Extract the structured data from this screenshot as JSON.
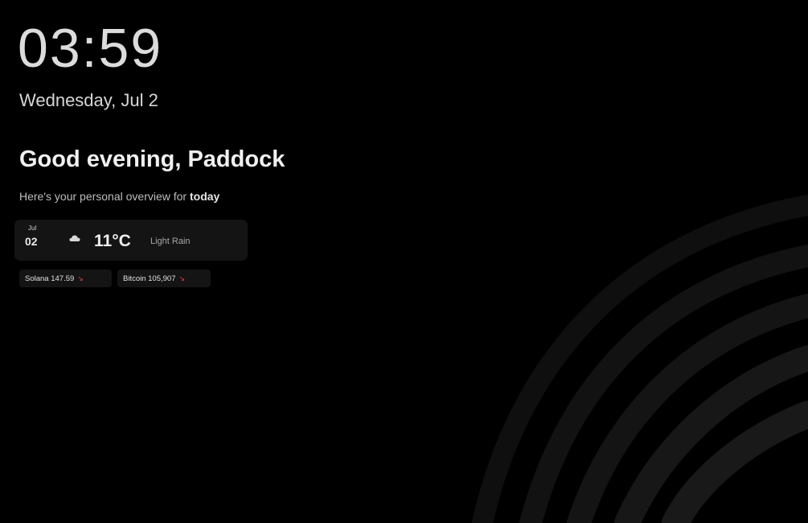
{
  "clock": {
    "time": "03:59",
    "date": "Wednesday, Jul 2"
  },
  "greeting": {
    "title": "Good evening, Paddock",
    "subtitle_prefix": "Here's your personal overview for ",
    "subtitle_emphasis": "today"
  },
  "weather": {
    "month": "Jul",
    "day": "02",
    "icon": "cloud-icon",
    "temperature": "11°C",
    "condition": "Light Rain"
  },
  "tickers": [
    {
      "label": "Solana 147.59",
      "trend_icon": "arrow-down-right-icon",
      "trend_glyph": "↘",
      "trend_color": "#e0453d"
    },
    {
      "label": "Bitcoin 105,907",
      "trend_icon": "arrow-down-right-icon",
      "trend_glyph": "↘",
      "trend_color": "#e0453d"
    }
  ],
  "colors": {
    "background": "#000000",
    "card": "#141414",
    "trend_down": "#e0453d"
  }
}
